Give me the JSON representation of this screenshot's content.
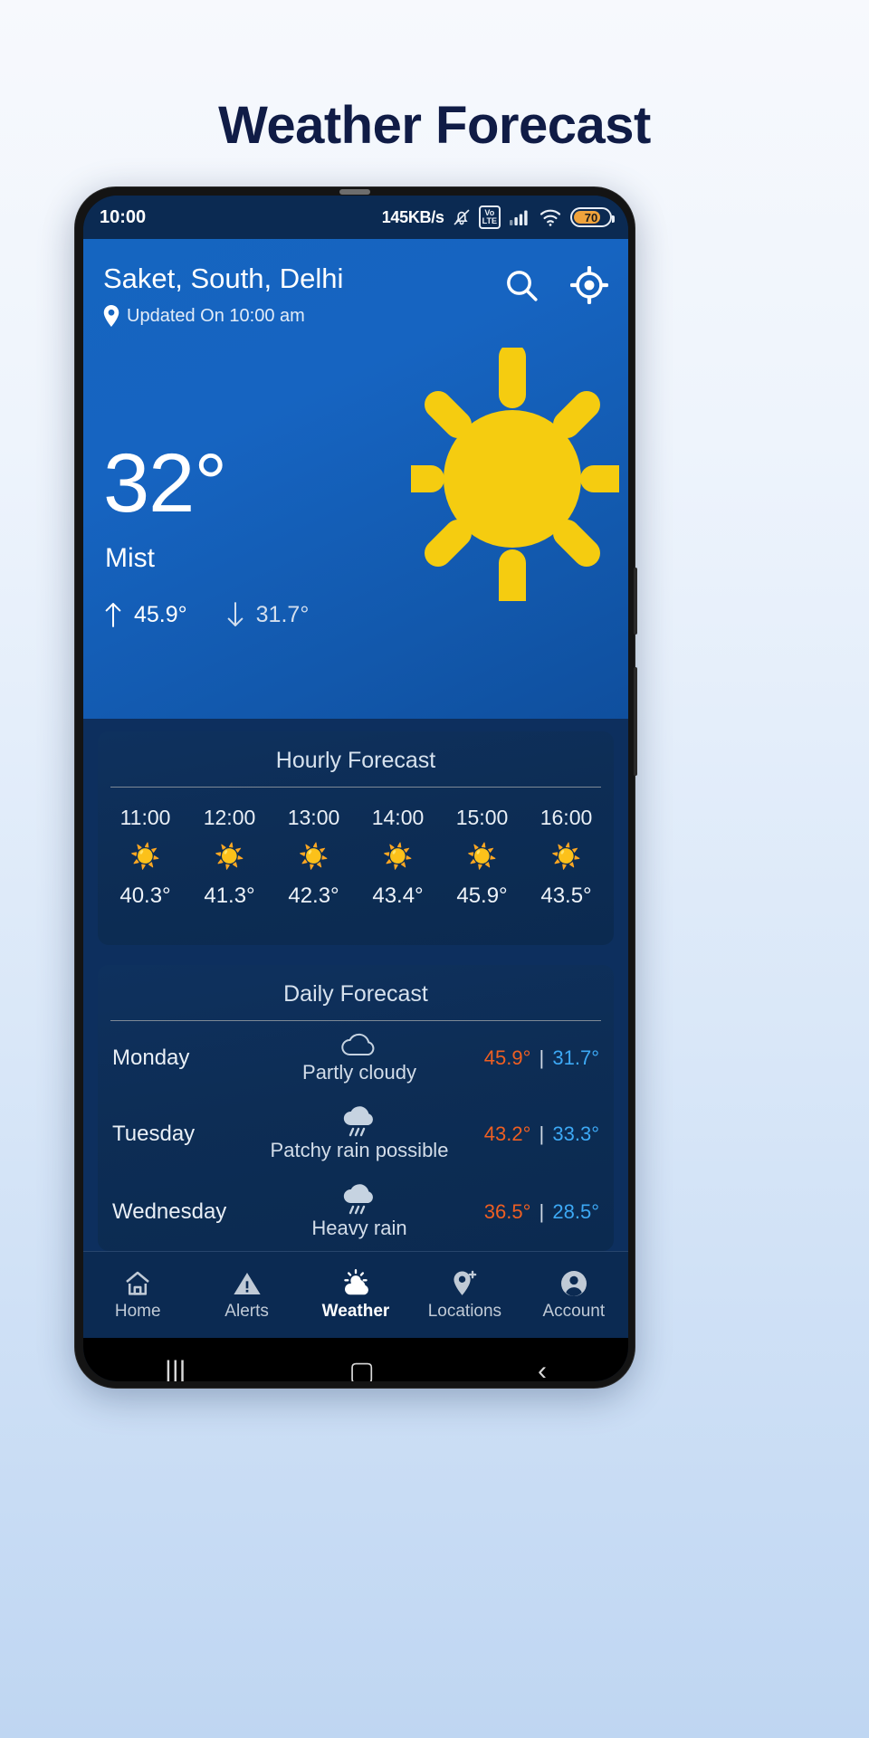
{
  "page": {
    "title": "Weather Forecast"
  },
  "statusbar": {
    "time": "10:00",
    "network_speed": "145KB/s",
    "volte_line1": "Vo",
    "volte_line2": "LTE",
    "battery_level": "70",
    "icons": [
      "mute-icon",
      "volte-icon",
      "signal-icon",
      "wifi-icon",
      "battery-icon"
    ]
  },
  "hero": {
    "city": "Saket, South, Delhi",
    "updated": "Updated On 10:00 am",
    "temperature": "32°",
    "condition": "Mist",
    "high": "45.9°",
    "low": "31.7°",
    "search_icon": "search-icon",
    "locate_icon": "gps-locate-icon",
    "weather_icon": "sun-icon",
    "colors": {
      "bg_from": "#1565c0",
      "bg_to": "#0f4f9e",
      "sun": "#f5cc10"
    }
  },
  "hourly": {
    "title": "Hourly Forecast",
    "items": [
      {
        "time": "11:00",
        "icon": "sun-icon",
        "temp": "40.3°"
      },
      {
        "time": "12:00",
        "icon": "sun-icon",
        "temp": "41.3°"
      },
      {
        "time": "13:00",
        "icon": "sun-icon",
        "temp": "42.3°"
      },
      {
        "time": "14:00",
        "icon": "sun-icon",
        "temp": "43.4°"
      },
      {
        "time": "15:00",
        "icon": "sun-icon",
        "temp": "45.9°"
      },
      {
        "time": "16:00",
        "icon": "sun-icon",
        "temp": "43.5°"
      }
    ]
  },
  "daily": {
    "title": "Daily Forecast",
    "separator": "|",
    "degree": "°",
    "items": [
      {
        "day": "Monday",
        "icon": "cloud-icon",
        "condition": "Partly cloudy",
        "high": "45.9",
        "low": "31.7"
      },
      {
        "day": "Tuesday",
        "icon": "cloud-rain-icon",
        "condition": "Patchy rain possible",
        "high": "43.2",
        "low": "33.3"
      },
      {
        "day": "Wednesday",
        "icon": "cloud-rain-icon",
        "condition": "Heavy rain",
        "high": "36.5",
        "low": "28.5"
      }
    ],
    "colors": {
      "high": "#ef5f22",
      "low": "#3da9f5"
    }
  },
  "bottomnav": {
    "items": [
      {
        "label": "Home",
        "icon": "home-icon",
        "active": false
      },
      {
        "label": "Alerts",
        "icon": "warning-icon",
        "active": false
      },
      {
        "label": "Weather",
        "icon": "sun-cloud-icon",
        "active": true
      },
      {
        "label": "Locations",
        "icon": "pin-plus-icon",
        "active": false
      },
      {
        "label": "Account",
        "icon": "account-icon",
        "active": false
      }
    ]
  },
  "sysnav": {
    "recents": "|||",
    "home": "▢",
    "back": "‹"
  }
}
